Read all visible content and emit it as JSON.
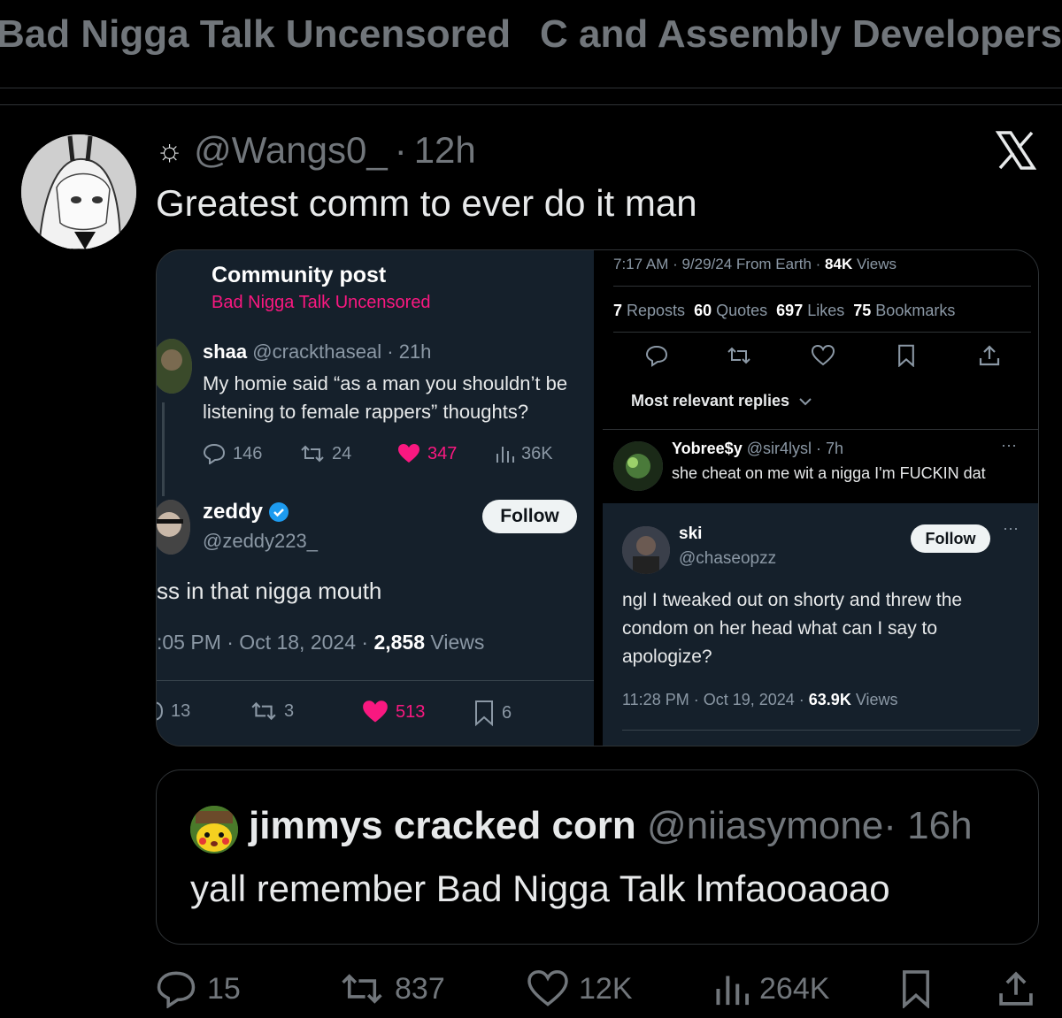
{
  "tabs": [
    "Bad Nigga Talk Uncensored",
    "C and Assembly Developers"
  ],
  "post": {
    "handle": "@Wangs0_",
    "sep": "·",
    "time": "12h",
    "text": "Greatest comm to ever do it man"
  },
  "media_left": {
    "header_title": "Community post",
    "header_community": "Bad Nigga Talk Uncensored",
    "parent": {
      "name": "shaa",
      "handle": "@crackthaseal",
      "time": "· 21h",
      "line1": "My homie said “as a man you shouldn’t be",
      "line2": "listening to female rappers” thoughts?",
      "replies": "146",
      "reposts": "24",
      "likes": "347",
      "views": "36K"
    },
    "reply": {
      "name": "zeddy",
      "handle": "@zeddy223_",
      "follow": "Follow",
      "text": "ss in that nigga mouth",
      "meta_time": ":05 PM · Oct 18, 2024 · ",
      "meta_views_num": "2,858",
      "meta_views_label": " Views",
      "replies": "13",
      "reposts": "3",
      "likes": "513",
      "bookmarks": "6"
    }
  },
  "media_right_top": {
    "meta_time": "7:17 AM · 9/29/24 From Earth · ",
    "meta_views_num": "84K",
    "meta_views_label": " Views",
    "reposts_num": "7",
    "reposts_label": " Reposts",
    "quotes_num": "60",
    "quotes_label": " Quotes",
    "likes_num": "697",
    "likes_label": " Likes",
    "bookmarks_num": "75",
    "bookmarks_label": " Bookmarks",
    "sort_label": "Most relevant replies",
    "reply": {
      "name": "Yobree$y",
      "handle": "@sir4lysl · 7h",
      "text": "she cheat on me wit a nigga I'm FUCKIN dat",
      "more": "···"
    }
  },
  "media_right_bot": {
    "name": "ski",
    "handle": "@chaseopzz",
    "follow": "Follow",
    "more": "···",
    "line1": "ngl I tweaked out on shorty and threw the",
    "line2": "condom on her head what can I say to",
    "line3": "apologize?",
    "meta_time": "11:28 PM · Oct 19, 2024 · ",
    "meta_views_num": "63.9K",
    "meta_views_label": " Views"
  },
  "quote": {
    "name": "jimmys cracked corn",
    "handle": "@niiasymone",
    "time": "· 16h",
    "text": "yall remember Bad Nigga Talk lmfaooaoao"
  },
  "actions": {
    "replies": "15",
    "reposts": "837",
    "likes": "12K",
    "views": "264K"
  },
  "colors": {
    "background": "#000000",
    "dim_panel": "#15202b",
    "accent_pink": "#f91880",
    "verified_blue": "#1d9bf0",
    "muted": "#71767b"
  }
}
